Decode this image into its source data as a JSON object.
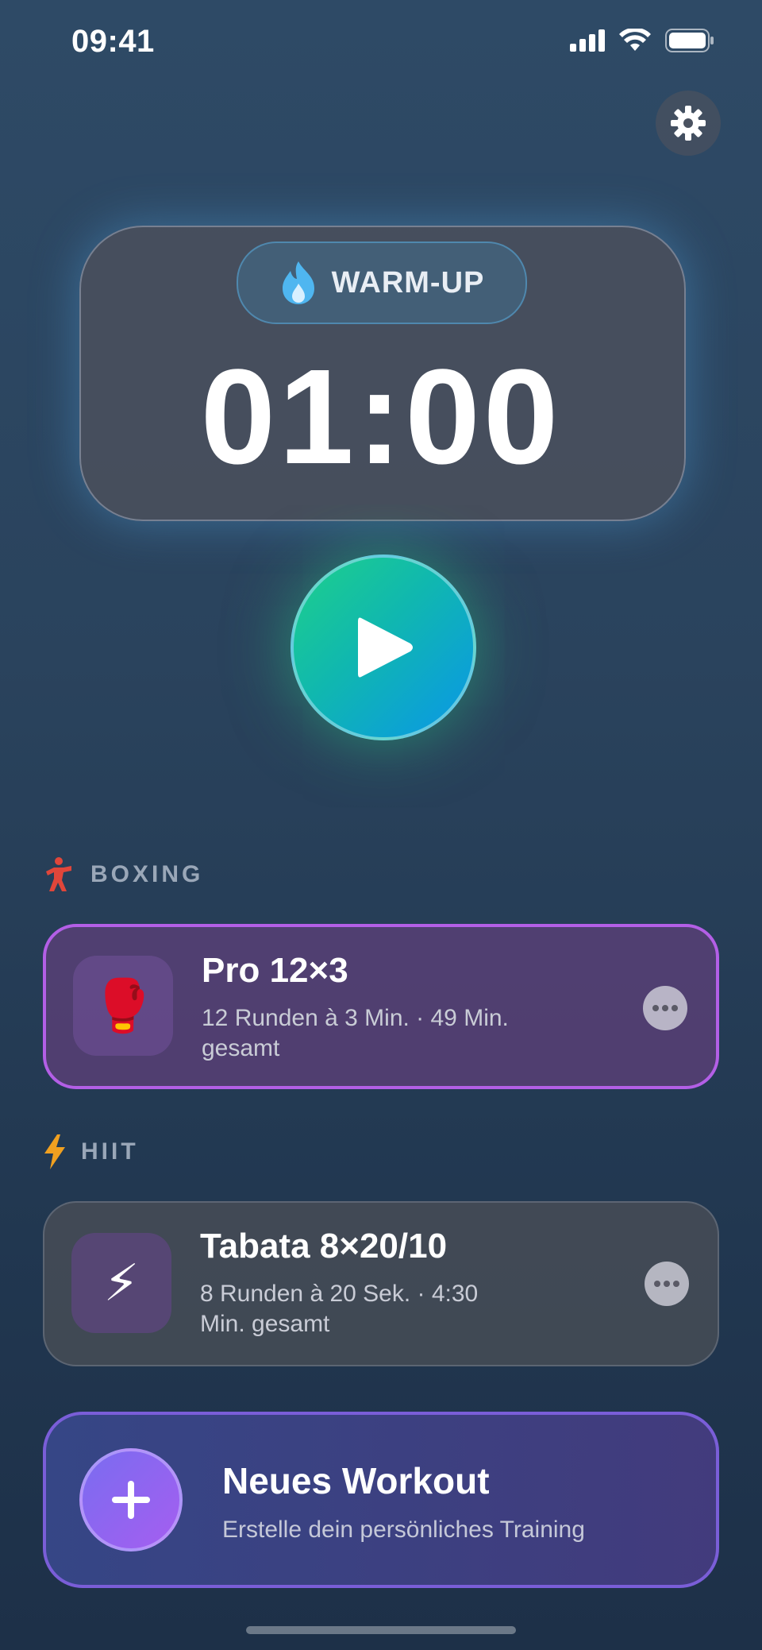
{
  "status_bar": {
    "time": "09:41"
  },
  "timer": {
    "phase": "WARM-UP",
    "value": "01:00"
  },
  "sections": [
    {
      "title": "BOXING",
      "icon": "boxer-icon",
      "workout": {
        "title": "Pro 12×3",
        "subtitle": "12 Runden à 3 Min. · 49 Min. gesamt",
        "icon": "boxing-glove-icon",
        "emoji": "🥊",
        "selected": true
      }
    },
    {
      "title": "HIIT",
      "icon": "lightning-icon",
      "workout": {
        "title": "Tabata 8×20/10",
        "subtitle": "8 Runden à 20 Sek. · 4:30 Min. gesamt",
        "icon": "lightning-icon",
        "emoji": "⚡",
        "selected": false
      }
    }
  ],
  "new_workout": {
    "title": "Neues Workout",
    "subtitle": "Erstelle dein persönliches Training"
  },
  "colors": {
    "accent_purple": "#b35fe6",
    "play_green": "#1ed08a",
    "play_blue": "#0a96e8"
  }
}
